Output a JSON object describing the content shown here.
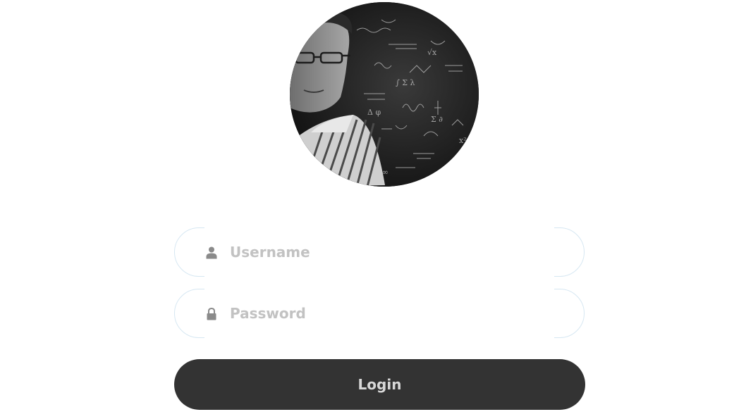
{
  "avatar": {
    "alt": "profile photo"
  },
  "login_form": {
    "username": {
      "placeholder": "Username",
      "value": "",
      "icon": "user-icon"
    },
    "password": {
      "placeholder": "Password",
      "value": "",
      "icon": "lock-icon"
    },
    "submit_label": "Login"
  },
  "colors": {
    "button_background": "#333333",
    "button_text": "#d8d8d8",
    "placeholder_text": "#c2c2c2",
    "icon": "#8a8a8a",
    "field_border": "#d6e7f2"
  }
}
